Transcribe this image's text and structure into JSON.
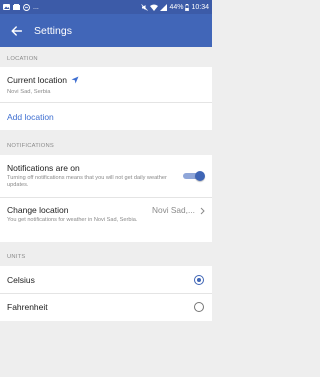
{
  "status_bar": {
    "left_icons": [
      "image-icon",
      "gallery-icon",
      "messenger-icon"
    ],
    "overflow": "...",
    "battery": "44%",
    "time": "10:34"
  },
  "header": {
    "title": "Settings",
    "accent_color": "#4166b8",
    "status_color": "#3c5ba8"
  },
  "location_section": {
    "label": "LOCATION",
    "current_location_title": "Current location",
    "current_location_value": "Novi Sad, Serbia",
    "add_location": "Add location",
    "link_color": "#3f6fd1"
  },
  "notifications_section": {
    "label": "NOTIFICATIONS",
    "notifications_title": "Notifications are on",
    "notifications_desc": "Turning off notifications means that you will not get daily weather updates.",
    "notifications_enabled": true,
    "change_location_title": "Change location",
    "change_location_value": "Novi Sad,...",
    "change_location_desc": "You get notifications for weather in Novi Sad, Serbia."
  },
  "units_section": {
    "label": "UNITS",
    "options": [
      {
        "label": "Celsius",
        "selected": true
      },
      {
        "label": "Fahrenheit",
        "selected": false
      }
    ]
  }
}
